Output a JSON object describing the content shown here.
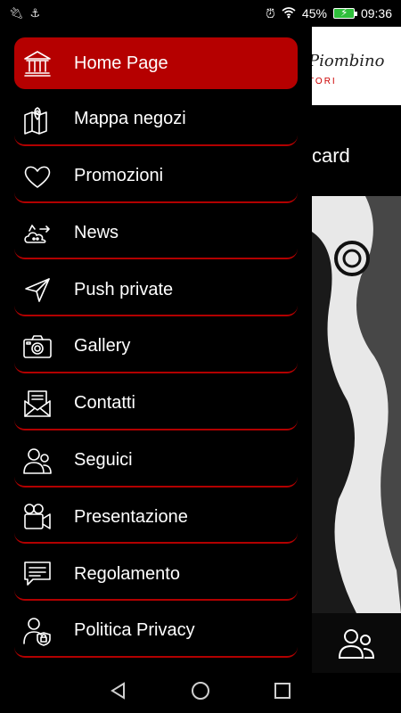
{
  "status_bar": {
    "battery_percent": "45%",
    "time": "09:36"
  },
  "background": {
    "logo_text": "Piombino",
    "logo_sub": "TORI",
    "card_text": "card"
  },
  "drawer": {
    "items": [
      {
        "label": "Home Page",
        "icon": "bank-icon",
        "active": true
      },
      {
        "label": "Mappa negozi",
        "icon": "map-icon",
        "active": false
      },
      {
        "label": "Promozioni",
        "icon": "heart-icon",
        "active": false
      },
      {
        "label": "News",
        "icon": "news-icon",
        "active": false
      },
      {
        "label": "Push private",
        "icon": "send-icon",
        "active": false
      },
      {
        "label": "Gallery",
        "icon": "camera-icon",
        "active": false
      },
      {
        "label": "Contatti",
        "icon": "mail-icon",
        "active": false
      },
      {
        "label": "Seguici",
        "icon": "users-icon",
        "active": false
      },
      {
        "label": "Presentazione",
        "icon": "video-icon",
        "active": false
      },
      {
        "label": "Regolamento",
        "icon": "chat-icon",
        "active": false
      },
      {
        "label": "Politica Privacy",
        "icon": "privacy-icon",
        "active": false
      }
    ]
  },
  "colors": {
    "accent": "#b50000",
    "background": "#000000"
  }
}
